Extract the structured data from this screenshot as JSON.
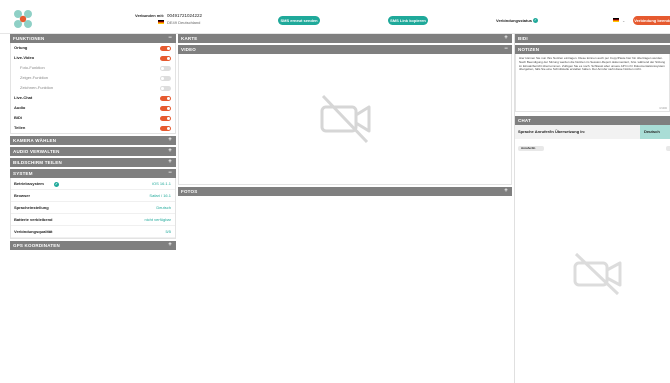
{
  "header": {
    "connected_label": "Verbunden mit:",
    "phone_number": "00491721024222",
    "country": "DE49 Deutschland",
    "sms_button": "SMS erneut senden",
    "copy_link_button": "SMS Link kopieren",
    "status_label": "Verbindungsstatus",
    "end_button": "Verbindung beenden"
  },
  "funktionen": {
    "title": "FUNKTIONEN",
    "items": [
      {
        "label": "Ortung",
        "on": true,
        "sub": false
      },
      {
        "label": "Live-Video",
        "on": true,
        "sub": false
      },
      {
        "label": "Foto-Funktion",
        "on": false,
        "sub": true
      },
      {
        "label": "Zeiger-Funktion",
        "on": false,
        "sub": true
      },
      {
        "label": "Zeichnen-Funktion",
        "on": false,
        "sub": true
      },
      {
        "label": "Live-Chat",
        "on": true,
        "sub": false
      },
      {
        "label": "Audio",
        "on": true,
        "sub": false
      },
      {
        "label": "BiDi",
        "on": true,
        "sub": false
      },
      {
        "label": "Teilen",
        "on": true,
        "sub": false
      }
    ]
  },
  "sections": {
    "kamera": "KAMERA WÄHLEN",
    "audio": "AUDIO VERWALTEN",
    "bildschirm": "BILDSCHIRM TEILEN",
    "gps": "GPS KOORDINATEN"
  },
  "system": {
    "title": "SYSTEM",
    "rows": [
      {
        "label": "Betriebssystem",
        "value": "iOS 16.1.1"
      },
      {
        "label": "Browser",
        "value": "Safari / 16.1"
      },
      {
        "label": "Spracheinstellung",
        "value": "Deutsch"
      },
      {
        "label": "Batterie verbleibend",
        "value": "nicht verfügbar"
      },
      {
        "label": "Verbindungsqualität",
        "value": "5/5"
      }
    ]
  },
  "center": {
    "karte": "KARTE",
    "video": "VIDEO",
    "fotos": "FOTOS"
  },
  "right": {
    "bidi": "BIDI",
    "notizen": "NOTIZEN",
    "notes_text": "Hier können Sie nun Ihre Notizen eintragen. Diese können auch per Copy/Paste hier hin übertragen werden. Nach Beendigung der Sitzung werden die Notizen im Session-Report dokumentiert, bzw. während der Sitzung im Einsatzbericht übernommen. Zufügen Sie es noch. Schliesst aber unsere API in ihr Dokumentationssystem übergeben, falls Sie eine Schnittstelle erstellen haben. Der Anrufer sieht diese Notizen nicht.",
    "notes_count": "0/1000",
    "chat": "CHAT",
    "lang_label": "Sprache Anrufer/In Übersetzung In:",
    "lang_value": "Deutsch",
    "anrufer": "Anrufer/In"
  },
  "colors": {
    "accent": "#1fa99a",
    "danger": "#e65a2f",
    "bar": "#7f7f7f"
  }
}
